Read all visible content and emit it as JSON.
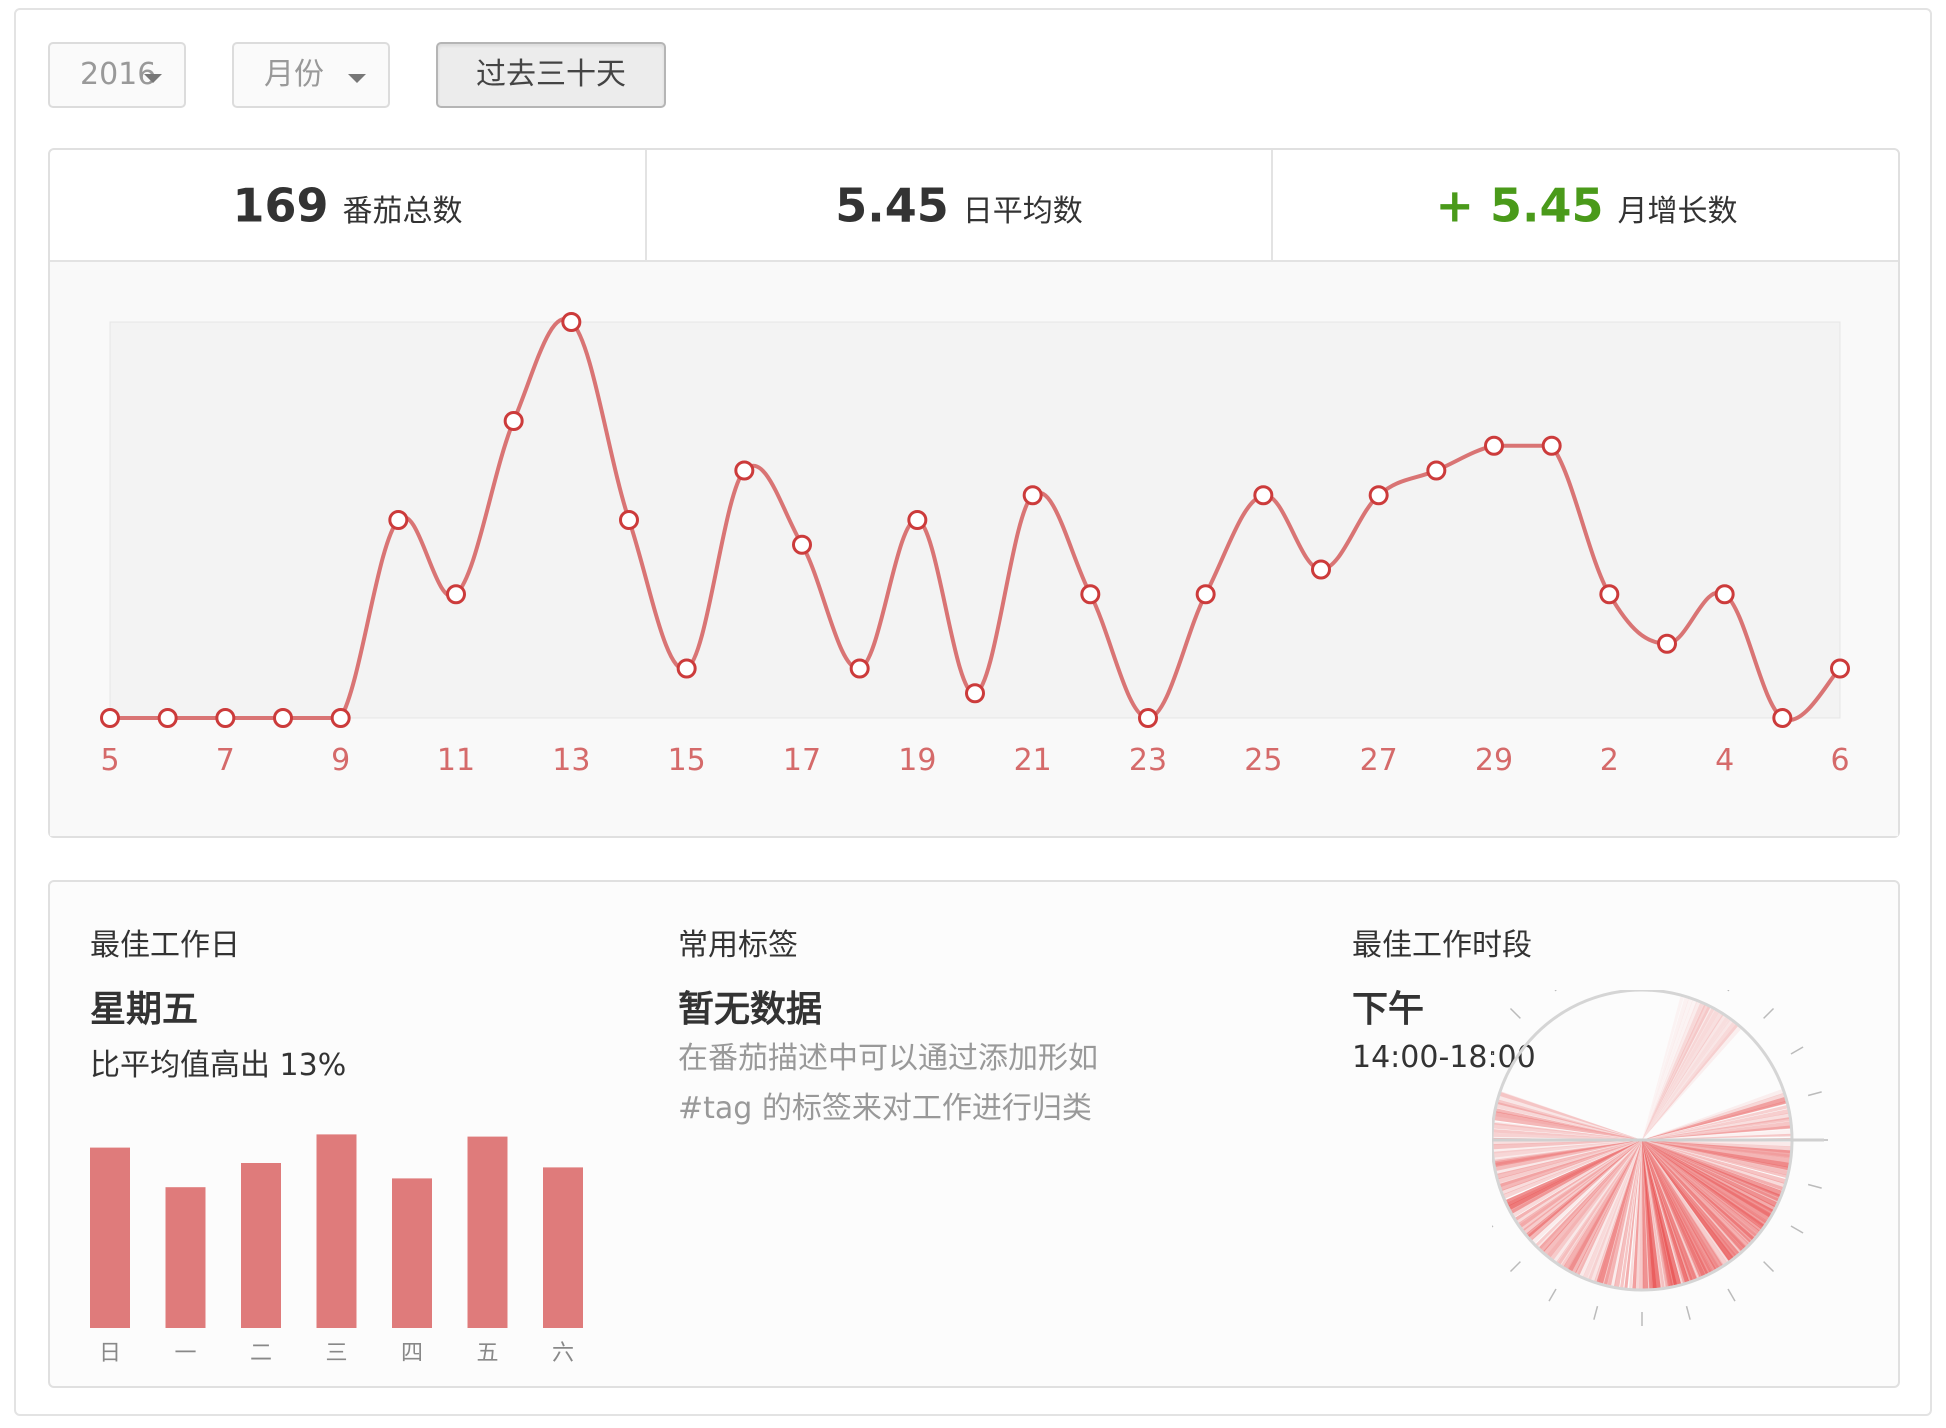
{
  "toolbar": {
    "year": "2016",
    "month_placeholder": "月份",
    "range_button": "过去三十天"
  },
  "stats": [
    {
      "value": "169",
      "label": "番茄总数"
    },
    {
      "value": "5.45",
      "label": "日平均数"
    },
    {
      "value": "+ 5.45",
      "label": "月增长数"
    }
  ],
  "chart_data": {
    "type": "line",
    "x": [
      "5",
      "6",
      "7",
      "8",
      "9",
      "10",
      "11",
      "12",
      "13",
      "14",
      "15",
      "16",
      "17",
      "18",
      "19",
      "20",
      "21",
      "22",
      "23",
      "24",
      "25",
      "26",
      "27",
      "28",
      "29",
      "30",
      "1",
      "2",
      "3",
      "4",
      "5",
      "6"
    ],
    "x_tick_labels": [
      "5",
      "7",
      "9",
      "11",
      "13",
      "15",
      "17",
      "19",
      "21",
      "23",
      "25",
      "27",
      "29",
      "2",
      "4",
      "6"
    ],
    "values": [
      0,
      0,
      0,
      0,
      0,
      8,
      5,
      12,
      16,
      8,
      2,
      10,
      7,
      2,
      8,
      1,
      9,
      5,
      0,
      5,
      9,
      6,
      9,
      10,
      11,
      11,
      5,
      3,
      5,
      0,
      2
    ],
    "ylim": [
      0,
      16
    ],
    "grid": false,
    "legend": "none",
    "colors": {
      "line": "#d97474",
      "point_stroke": "#cc3b3b",
      "plot_bg": "#f3f3f3",
      "tick": "#d56a6a"
    }
  },
  "best_day": {
    "title": "最佳工作日",
    "value": "星期五",
    "sub": "比平均值高出 13%",
    "chart_data": {
      "type": "bar",
      "categories": [
        "日",
        "一",
        "二",
        "三",
        "四",
        "五",
        "六"
      ],
      "values": [
        82,
        64,
        75,
        88,
        68,
        87,
        73
      ],
      "ylim": [
        0,
        100
      ],
      "color": "#df7b7b"
    }
  },
  "tags": {
    "title": "常用标签",
    "value": "暂无数据",
    "desc_line1": "在番茄描述中可以通过添加形如",
    "desc_line2": "#tag 的标签来对工作进行归类"
  },
  "best_time": {
    "title": "最佳工作时段",
    "value": "下午",
    "range": "14:00-18:00",
    "clock_color": "#e84a4a"
  }
}
